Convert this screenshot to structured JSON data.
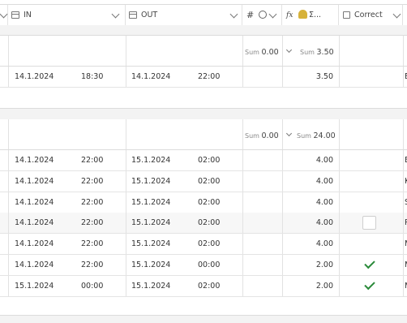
{
  "columns": {
    "in_label": "IN",
    "out_label": "OUT",
    "number_label": "#",
    "formula_label": "Σ...",
    "correct_label": "Correct",
    "formula_prefix": "fx"
  },
  "groups": [
    {
      "sum_number_label": "Sum",
      "sum_number_value": "0.00",
      "sum_formula_label": "Sum",
      "sum_formula_value": "3.50",
      "rows": [
        {
          "in_date": "14.1.2024",
          "in_time": "18:30",
          "out_date": "14.1.2024",
          "out_time": "22:00",
          "hours": "3.50",
          "correct": "none",
          "extra": "E"
        }
      ]
    },
    {
      "sum_number_label": "Sum",
      "sum_number_value": "0.00",
      "sum_formula_label": "Sum",
      "sum_formula_value": "24.00",
      "rows": [
        {
          "in_date": "14.1.2024",
          "in_time": "22:00",
          "out_date": "15.1.2024",
          "out_time": "02:00",
          "hours": "4.00",
          "correct": "none",
          "extra": "E"
        },
        {
          "in_date": "14.1.2024",
          "in_time": "22:00",
          "out_date": "15.1.2024",
          "out_time": "02:00",
          "hours": "4.00",
          "correct": "none",
          "extra": "K"
        },
        {
          "in_date": "14.1.2024",
          "in_time": "22:00",
          "out_date": "15.1.2024",
          "out_time": "02:00",
          "hours": "4.00",
          "correct": "none",
          "extra": "S"
        },
        {
          "in_date": "14.1.2024",
          "in_time": "22:00",
          "out_date": "15.1.2024",
          "out_time": "02:00",
          "hours": "4.00",
          "correct": "box",
          "extra": "P"
        },
        {
          "in_date": "14.1.2024",
          "in_time": "22:00",
          "out_date": "15.1.2024",
          "out_time": "02:00",
          "hours": "4.00",
          "correct": "none",
          "extra": "M"
        },
        {
          "in_date": "14.1.2024",
          "in_time": "22:00",
          "out_date": "15.1.2024",
          "out_time": "00:00",
          "hours": "2.00",
          "correct": "check",
          "extra": "M"
        },
        {
          "in_date": "15.1.2024",
          "in_time": "00:00",
          "out_date": "15.1.2024",
          "out_time": "02:00",
          "hours": "2.00",
          "correct": "check",
          "extra": "M"
        }
      ]
    }
  ],
  "colors": {
    "check": "#2a8a3a",
    "border": "#dcdcdc",
    "gap": "#f3f3f3"
  }
}
